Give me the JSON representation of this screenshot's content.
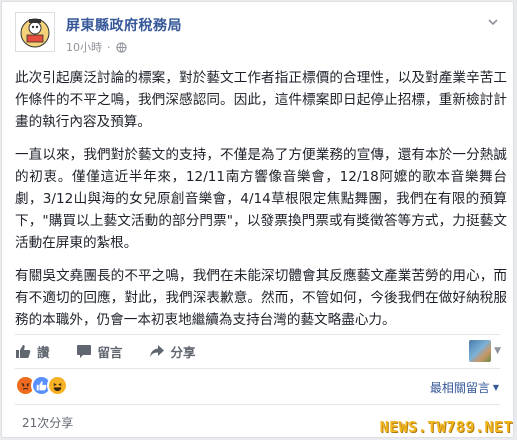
{
  "post": {
    "page_name": "屏東縣政府稅務局",
    "time": "10小時",
    "paragraphs": [
      "此次引起廣泛討論的標案，對於藝文工作者指正標價的合理性，以及對產業辛苦工作條件的不平之鳴，我們深感認同。因此，這件標案即日起停止招標，重新檢討計畫的執行內容及預算。",
      "一直以來，我們對於藝文的支持，不僅是為了方便業務的宣傳，還有本於一分熱誠的初衷。僅僅這近半年來，12/11南方響像音樂會，12/18阿嬤的歌本音樂舞台劇，3/12山與海的女兒原創音樂會，4/14草根限定焦點舞團，我們在有限的預算下，\"購買以上藝文活動的部分門票\"，以發票換門票或有獎徵答等方式，力挺藝文活動在屏東的紮根。",
      "有關吳文堯團長的不平之鳴，我們在未能深切體會其反應藝文產業苦勞的用心，而有不適切的回應，對此，我們深表歉意。然而，不管如何，今後我們在做好納稅服務的本職外，仍會一本初衷地繼續為支持台灣的藝文略盡心力。"
    ]
  },
  "actions": {
    "like": "讚",
    "comment": "留言",
    "share": "分享"
  },
  "footer": {
    "sort_label": "最相關留言",
    "shares": "21次分享"
  },
  "watermark": "NEWS.TW789.NET",
  "colors": {
    "link": "#365899",
    "text": "#1d2129",
    "muted": "#90949c",
    "angry": "#e9710f",
    "like": "#5890ff",
    "haha": "#f7b125",
    "watermark": "#f2b71f"
  },
  "icons": [
    "avatar-logo",
    "globe-icon",
    "chevron-down-icon",
    "like-icon",
    "comment-icon",
    "share-icon",
    "angry-reaction-icon",
    "like-reaction-icon",
    "haha-reaction-icon",
    "caret-down-icon"
  ]
}
